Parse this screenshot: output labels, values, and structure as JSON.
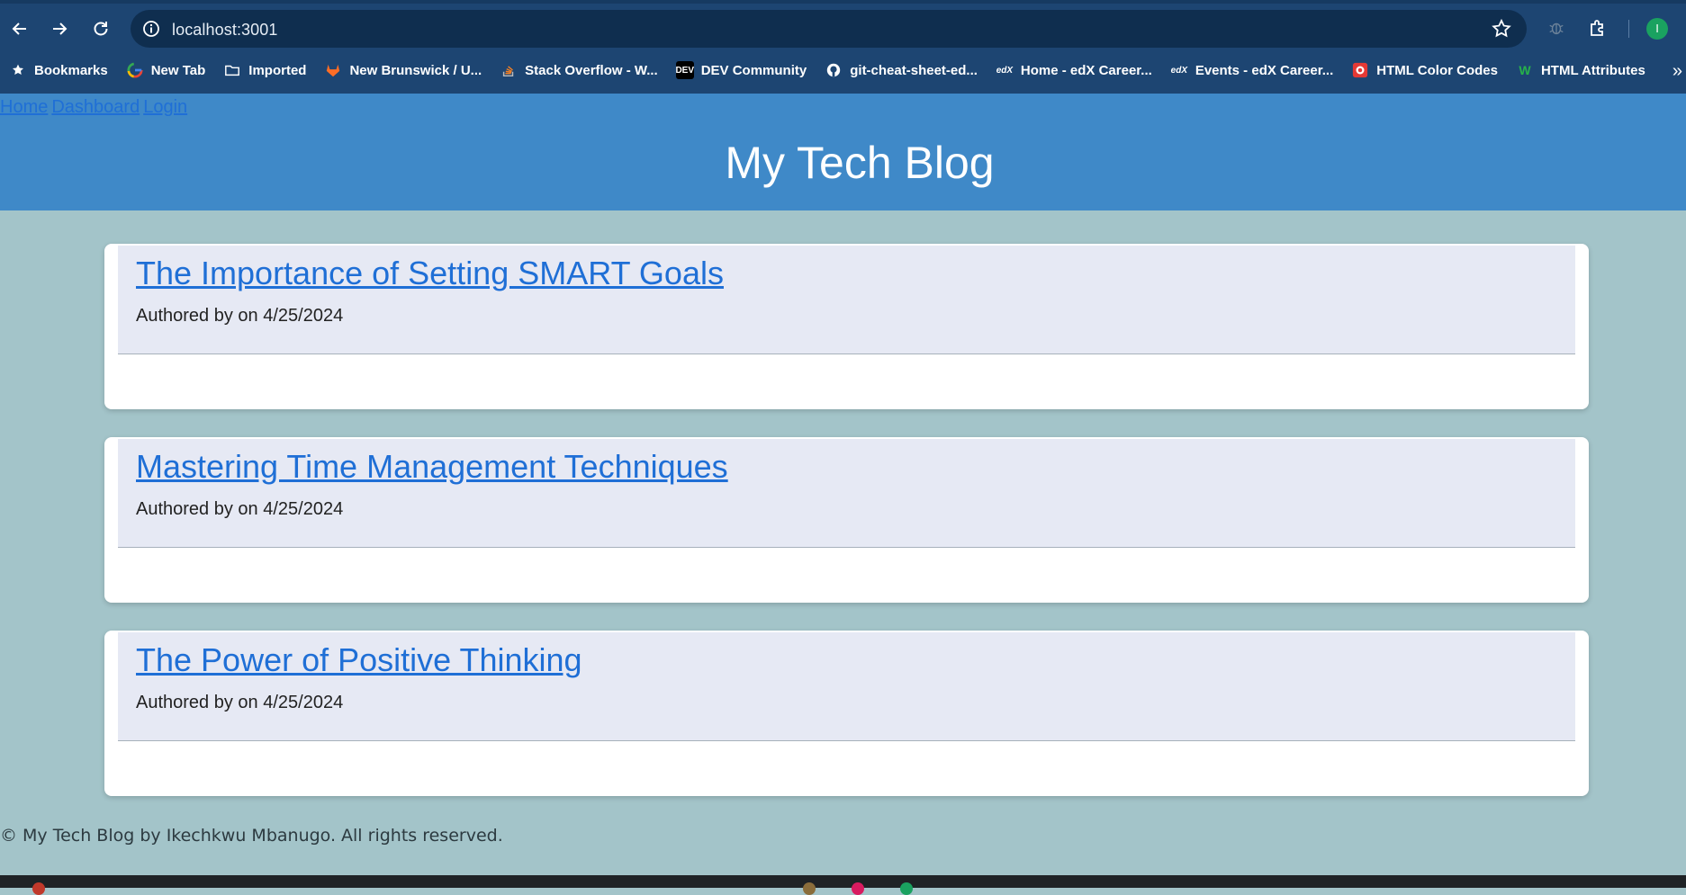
{
  "browser": {
    "url": "localhost:3001",
    "profile_initial": "I",
    "bookmarks": [
      {
        "label": "Bookmarks",
        "icon": "star-icon"
      },
      {
        "label": "New Tab",
        "icon": "google-icon"
      },
      {
        "label": "Imported",
        "icon": "folder-icon"
      },
      {
        "label": "New Brunswick / U...",
        "icon": "gitlab-icon"
      },
      {
        "label": "Stack Overflow - W...",
        "icon": "stackoverflow-icon"
      },
      {
        "label": "DEV Community",
        "icon": "dev-icon"
      },
      {
        "label": "git-cheat-sheet-ed...",
        "icon": "github-icon"
      },
      {
        "label": "Home - edX Career...",
        "icon": "edx-icon"
      },
      {
        "label": "Events - edX Career...",
        "icon": "edx-icon"
      },
      {
        "label": "HTML Color Codes",
        "icon": "htmlcolorcodes-icon"
      },
      {
        "label": "HTML Attributes",
        "icon": "w-icon"
      }
    ],
    "overflow_label": "»"
  },
  "nav": {
    "home": "Home",
    "dashboard": "Dashboard",
    "login": "Login"
  },
  "site": {
    "title": "My Tech Blog",
    "footer": "© My Tech Blog by Ikechkwu Mbanugo. All rights reserved."
  },
  "posts": [
    {
      "title": "The Importance of Setting SMART Goals",
      "meta": "Authored by on 4/25/2024"
    },
    {
      "title": "Mastering Time Management Techniques",
      "meta": "Authored by on 4/25/2024"
    },
    {
      "title": "The Power of Positive Thinking",
      "meta": "Authored by on 4/25/2024"
    }
  ],
  "colors": {
    "chrome": "#1d4572",
    "header": "#3f89c8",
    "page_bg": "#a3c4c9",
    "link": "#1f6fd6",
    "post_head": "#e6e9f4"
  }
}
